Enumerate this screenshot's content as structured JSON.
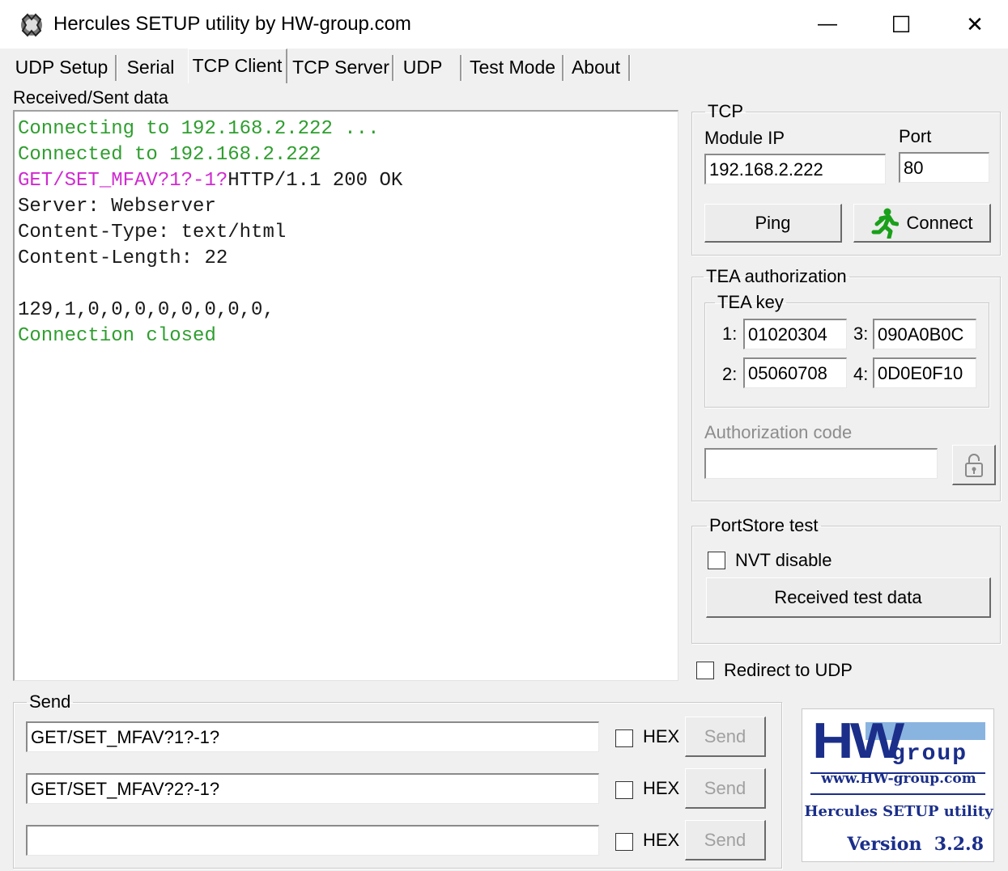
{
  "window": {
    "title": "Hercules SETUP utility by HW-group.com",
    "minimize_label": "—",
    "maximize_label": "☐",
    "close_label": "✕"
  },
  "tabs": [
    {
      "label": "UDP Setup",
      "active": false
    },
    {
      "label": "Serial",
      "active": false
    },
    {
      "label": "TCP Client",
      "active": true
    },
    {
      "label": "TCP Server",
      "active": false
    },
    {
      "label": "UDP",
      "active": false
    },
    {
      "label": "Test Mode",
      "active": false
    },
    {
      "label": "About",
      "active": false
    }
  ],
  "console": {
    "label": "Received/Sent data",
    "lines": [
      [
        {
          "text": "Connecting to 192.168.2.222 ...",
          "color": "green"
        }
      ],
      [
        {
          "text": "Connected to 192.168.2.222",
          "color": "green"
        }
      ],
      [
        {
          "text": "GET/SET_MFAV?1?-1?",
          "color": "magenta"
        },
        {
          "text": "HTTP/1.1 200 OK",
          "color": "black"
        }
      ],
      [
        {
          "text": "Server: Webserver",
          "color": "black"
        }
      ],
      [
        {
          "text": "Content-Type: text/html",
          "color": "black"
        }
      ],
      [
        {
          "text": "Content-Length: 22",
          "color": "black"
        }
      ],
      [
        {
          "text": "",
          "color": "black"
        }
      ],
      [
        {
          "text": "129,1,0,0,0,0,0,0,0,0,",
          "color": "black"
        }
      ],
      [
        {
          "text": "Connection closed",
          "color": "green"
        }
      ]
    ]
  },
  "tcp": {
    "group_label": "TCP",
    "module_ip_label": "Module IP",
    "module_ip_value": "192.168.2.222",
    "port_label": "Port",
    "port_value": "80",
    "ping_label": "Ping",
    "connect_label": "Connect"
  },
  "tea": {
    "group_label": "TEA authorization",
    "key_group_label": "TEA key",
    "keys": [
      {
        "index": "1:",
        "value": "01020304"
      },
      {
        "index": "3:",
        "value": "090A0B0C"
      },
      {
        "index": "2:",
        "value": "05060708"
      },
      {
        "index": "4:",
        "value": "0D0E0F10"
      }
    ],
    "auth_code_label": "Authorization code",
    "auth_code_value": ""
  },
  "portstore": {
    "group_label": "PortStore test",
    "nvt_disable_label": "NVT disable",
    "received_test_data_label": "Received test data"
  },
  "redirect_label": "Redirect to UDP",
  "send": {
    "group_label": "Send",
    "rows": [
      {
        "value": "GET/SET_MFAV?1?-1?",
        "hex_label": "HEX",
        "send_label": "Send"
      },
      {
        "value": "GET/SET_MFAV?2?-1?",
        "hex_label": "HEX",
        "send_label": "Send"
      },
      {
        "value": "",
        "hex_label": "HEX",
        "send_label": "Send"
      }
    ]
  },
  "logo": {
    "brand_hw": "HW",
    "brand_group": "group",
    "url": "www.HW-group.com",
    "product": "Hercules SETUP utility",
    "version": "Version  3.2.8",
    "bar_color": "#8ab4e0",
    "text_color": "#1a2e8a"
  },
  "colors": {
    "console_green": "#2f9e2f",
    "console_magenta": "#d02ad0",
    "connect_icon": "#1aa01a"
  }
}
